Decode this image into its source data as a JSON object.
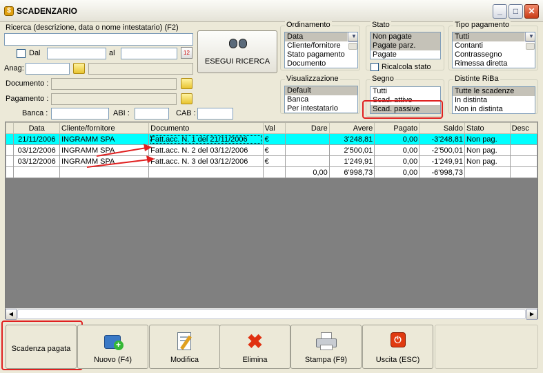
{
  "window": {
    "title": "SCADENZARIO",
    "icon": "app-icon",
    "controls": [
      "minimize-icon",
      "maximize-icon",
      "close-icon"
    ]
  },
  "search": {
    "label": "Ricerca (descrizione, data o nome intestatario) (F2)",
    "value": "",
    "dal_label": "Dal",
    "al_label": "al",
    "anag_label": "Anag:",
    "documento_label": "Documento :",
    "pagamento_label": "Pagamento :",
    "banca_label": "Banca :",
    "abi_label": "ABI :",
    "cab_label": "CAB :",
    "button_label": "ESEGUI RICERCA"
  },
  "ordinamento": {
    "title": "Ordinamento",
    "items": [
      "Data",
      "Cliente/fornitore",
      "Stato pagamento",
      "Documento"
    ],
    "selected": "Data"
  },
  "stato": {
    "title": "Stato",
    "items": [
      "Non pagate",
      "Pagate parz.",
      "Pagate"
    ],
    "selected": [
      "Non pagate",
      "Pagate parz."
    ],
    "ricalcola_label": "Ricalcola stato"
  },
  "tipo_pagamento": {
    "title": "Tipo pagamento",
    "items": [
      "Tutti",
      "Contanti",
      "Contrassegno",
      "Rimessa diretta"
    ],
    "selected": "Tutti"
  },
  "visualizzazione": {
    "title": "Visualizzazione",
    "items": [
      "Default",
      "Banca",
      "Per intestatario"
    ],
    "selected": "Default"
  },
  "segno": {
    "title": "Segno",
    "items": [
      "Tutti",
      "Scad. attive",
      "Scad. passive"
    ],
    "selected": "Scad. passive"
  },
  "distinte": {
    "title": "Distinte RiBa",
    "items": [
      "Tutte le scadenze",
      "In distinta",
      "Non in distinta"
    ],
    "selected": "Tutte le scadenze"
  },
  "table": {
    "columns": [
      "Data",
      "Cliente/fornitore",
      "Documento",
      "Val",
      "Dare",
      "Avere",
      "Pagato",
      "Saldo",
      "Stato",
      "Desc"
    ],
    "rows": [
      {
        "data": "21/11/2006",
        "cliente": "INGRAMM SPA",
        "documento": "Fatt.acc. N. 1 del 21/11/2006",
        "val": "€",
        "dare": "",
        "avere": "3'248,81",
        "pagato": "0,00",
        "saldo": "-3'248,81",
        "stato": "Non pag.",
        "desc": ""
      },
      {
        "data": "03/12/2006",
        "cliente": "INGRAMM SPA",
        "documento": "Fatt.acc. N. 2 del 03/12/2006",
        "val": "€",
        "dare": "",
        "avere": "2'500,01",
        "pagato": "0,00",
        "saldo": "-2'500,01",
        "stato": "Non pag.",
        "desc": ""
      },
      {
        "data": "03/12/2006",
        "cliente": "INGRAMM SPA",
        "documento": "Fatt.acc. N. 3 del 03/12/2006",
        "val": "€",
        "dare": "",
        "avere": "1'249,91",
        "pagato": "0,00",
        "saldo": "-1'249,91",
        "stato": "Non pag.",
        "desc": ""
      }
    ],
    "totals": {
      "dare": "0,00",
      "avere": "6'998,73",
      "pagato": "0,00",
      "saldo": "-6'998,73"
    }
  },
  "toolbar": {
    "scadenza": "Scadenza pagata",
    "nuovo": "Nuovo (F4)",
    "modifica": "Modifica",
    "elimina": "Elimina",
    "stampa": "Stampa (F9)",
    "uscita": "Uscita (ESC)"
  },
  "colors": {
    "highlight_row": "#00ffff",
    "annotation": "#e02020",
    "window_bg": "#ece9d8"
  }
}
